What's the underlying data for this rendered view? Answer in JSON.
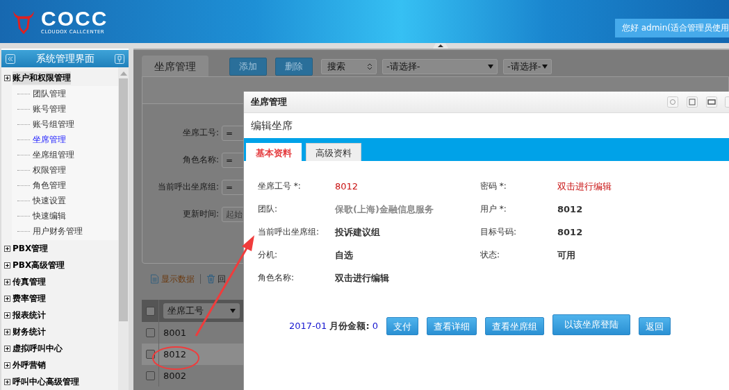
{
  "header": {
    "logo_text": "COCC",
    "logo_subtitle": "CLOUDOX CALLCENTER",
    "greeting": "您好 admin(适合管理员使用"
  },
  "sidebar": {
    "title": "系统管理界面",
    "items": [
      {
        "label": "账户和权限管理",
        "expanded": true,
        "children": [
          {
            "label": "团队管理",
            "selected": false
          },
          {
            "label": "账号管理",
            "selected": false
          },
          {
            "label": "账号组管理",
            "selected": false
          },
          {
            "label": "坐席管理",
            "selected": true
          },
          {
            "label": "坐席组管理",
            "selected": false
          },
          {
            "label": "权限管理",
            "selected": false
          },
          {
            "label": "角色管理",
            "selected": false
          },
          {
            "label": "快速设置",
            "selected": false
          },
          {
            "label": "快速编辑",
            "selected": false
          },
          {
            "label": "用户财务管理",
            "selected": false
          }
        ]
      },
      {
        "label": "PBX管理",
        "expanded": false
      },
      {
        "label": "PBX高级管理",
        "expanded": false
      },
      {
        "label": "传真管理",
        "expanded": false
      },
      {
        "label": "费率管理",
        "expanded": false
      },
      {
        "label": "报表统计",
        "expanded": false
      },
      {
        "label": "财务统计",
        "expanded": false
      },
      {
        "label": "虚拟呼叫中心",
        "expanded": false
      },
      {
        "label": "外呼营销",
        "expanded": false
      },
      {
        "label": "呼叫中心高级管理",
        "expanded": false
      }
    ]
  },
  "main": {
    "tab": "坐席管理",
    "toolbar": {
      "buttons": [
        "添加",
        "删除"
      ],
      "search_select": "搜索",
      "select_1": "-请选择-",
      "select_2": "-请选择-"
    },
    "search_form": [
      {
        "label": "坐席工号:",
        "value": "="
      },
      {
        "label": "角色名称:",
        "value": "="
      },
      {
        "label": "当前呼出坐席组:",
        "value": "="
      },
      {
        "label": "更新时间:",
        "placeholder": "起始"
      }
    ],
    "actions": [
      {
        "label": "显示数据",
        "kind": "document"
      },
      {
        "label": "回",
        "kind": "trash"
      }
    ],
    "table": {
      "select_all_checked": false,
      "column_1": "坐席工号",
      "rows": [
        {
          "cell": "8001",
          "selected": false,
          "checked": false
        },
        {
          "cell": "8012",
          "selected": true,
          "checked": false
        },
        {
          "cell": "8002",
          "selected": false,
          "checked": false
        }
      ]
    }
  },
  "dialog": {
    "title": "坐席管理",
    "subtitle": "编辑坐席",
    "tabs": [
      {
        "label": "基本资料",
        "selected": true
      },
      {
        "label": "高级资料",
        "selected": false
      }
    ],
    "fields": [
      {
        "label": "坐席工号 *:",
        "value": "8012",
        "kind": "alert"
      },
      {
        "label": "密码 *:",
        "value": "双击进行编辑",
        "kind": "alert"
      },
      {
        "label": "团队:",
        "value": "保歌(上海)金融信息服务",
        "kind": "muted"
      },
      {
        "label": "用户 *:",
        "value": "8012",
        "kind": "strong"
      },
      {
        "label": "当前呼出坐席组:",
        "value": "投诉建议组",
        "kind": "strong"
      },
      {
        "label": "目标号码:",
        "value": "8012",
        "kind": "strong"
      },
      {
        "label": "分机:",
        "value": "自选",
        "kind": "strong"
      },
      {
        "label": "状态:",
        "value": "可用",
        "kind": "strong"
      },
      {
        "label": "角色名称:",
        "value": "双击进行编辑",
        "kind": "strong"
      }
    ],
    "balance": {
      "month": "2017-01",
      "label": "月份金额:",
      "amount": "0"
    },
    "buttons": [
      "支付",
      "查看详细",
      "查看坐席组",
      "以该坐席登陆",
      "返回"
    ]
  }
}
